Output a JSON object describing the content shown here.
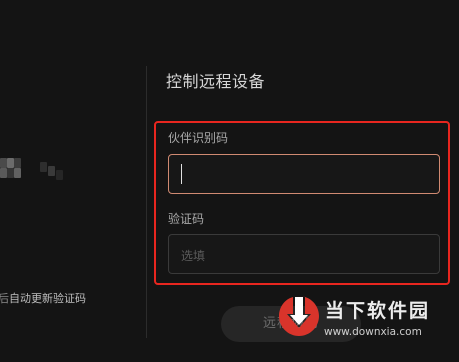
{
  "left_panel": {
    "auto_update_prefix": "后",
    "auto_update_text": "自动更新验证码"
  },
  "control": {
    "title": "控制远程设备",
    "partner_id": {
      "label": "伙伴识别码",
      "value": ""
    },
    "verification": {
      "label": "验证码",
      "placeholder": "选填"
    },
    "connect_button_label": "远程协助"
  },
  "watermark": {
    "title": "当下软件园",
    "url": "www.downxia.com",
    "logo_color": "#d9342b"
  },
  "colors": {
    "background": "#141414",
    "highlight": "#e8261f",
    "focus_border": "#d08a72"
  }
}
